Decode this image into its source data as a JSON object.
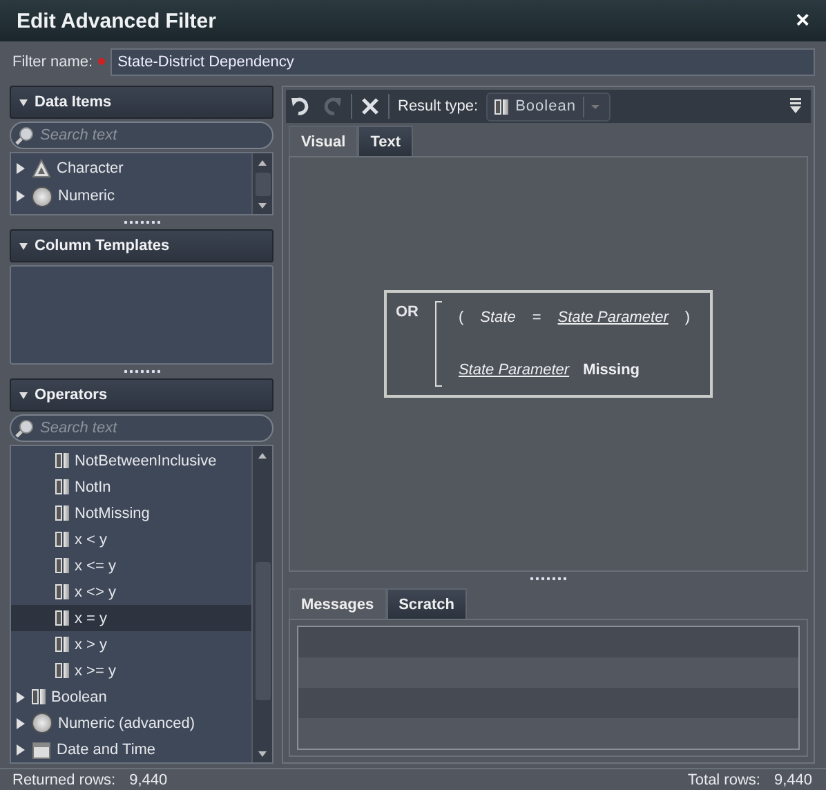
{
  "window": {
    "title": "Edit Advanced Filter",
    "close": "×"
  },
  "filter_name": {
    "label": "Filter name:",
    "required": true,
    "value": "State-District Dependency"
  },
  "data_items": {
    "title": "Data Items",
    "expanded": true,
    "search": {
      "placeholder": "Search text"
    },
    "items": [
      {
        "label": "Character",
        "kind": "character-group",
        "selected": false
      },
      {
        "label": "Numeric",
        "kind": "numeric-group",
        "selected": false
      }
    ]
  },
  "column_templates": {
    "title": "Column Templates",
    "expanded": true
  },
  "operators": {
    "title": "Operators",
    "expanded": true,
    "search": {
      "placeholder": "Search text"
    },
    "items": [
      {
        "label": "NotBetweenInclusive",
        "kind": "operator",
        "selected": false
      },
      {
        "label": "NotIn",
        "kind": "operator",
        "selected": false
      },
      {
        "label": "NotMissing",
        "kind": "operator",
        "selected": false
      },
      {
        "label": "x < y",
        "kind": "operator",
        "selected": false
      },
      {
        "label": "x <= y",
        "kind": "operator",
        "selected": false
      },
      {
        "label": "x <> y",
        "kind": "operator",
        "selected": false
      },
      {
        "label": "x = y",
        "kind": "operator",
        "selected": true
      },
      {
        "label": "x > y",
        "kind": "operator",
        "selected": false
      },
      {
        "label": "x >= y",
        "kind": "operator",
        "selected": false
      },
      {
        "label": "Boolean",
        "kind": "boolean-group",
        "selected": false
      },
      {
        "label": "Numeric (advanced)",
        "kind": "numeric-group",
        "selected": false
      },
      {
        "label": "Date and Time",
        "kind": "date-group",
        "selected": false
      }
    ]
  },
  "toolbar": {
    "result_type_label": "Result type:",
    "result_type": "Boolean"
  },
  "editor_tabs": [
    {
      "label": "Visual",
      "selected": true
    },
    {
      "label": "Text",
      "selected": false
    }
  ],
  "expression": {
    "operator": "OR",
    "clauses": [
      {
        "kind": "comparison",
        "open": "(",
        "left": "State",
        "op": "=",
        "right": "State Parameter",
        "close": ")"
      },
      {
        "kind": "missing",
        "operand": "State Parameter",
        "keyword": "Missing"
      }
    ]
  },
  "bottom_tabs": [
    {
      "label": "Messages",
      "selected": true
    },
    {
      "label": "Scratch",
      "selected": false
    }
  ],
  "status_bar": {
    "returned_label": "Returned rows:",
    "returned": "9,440",
    "total_label": "Total rows:",
    "total": "9,440"
  }
}
